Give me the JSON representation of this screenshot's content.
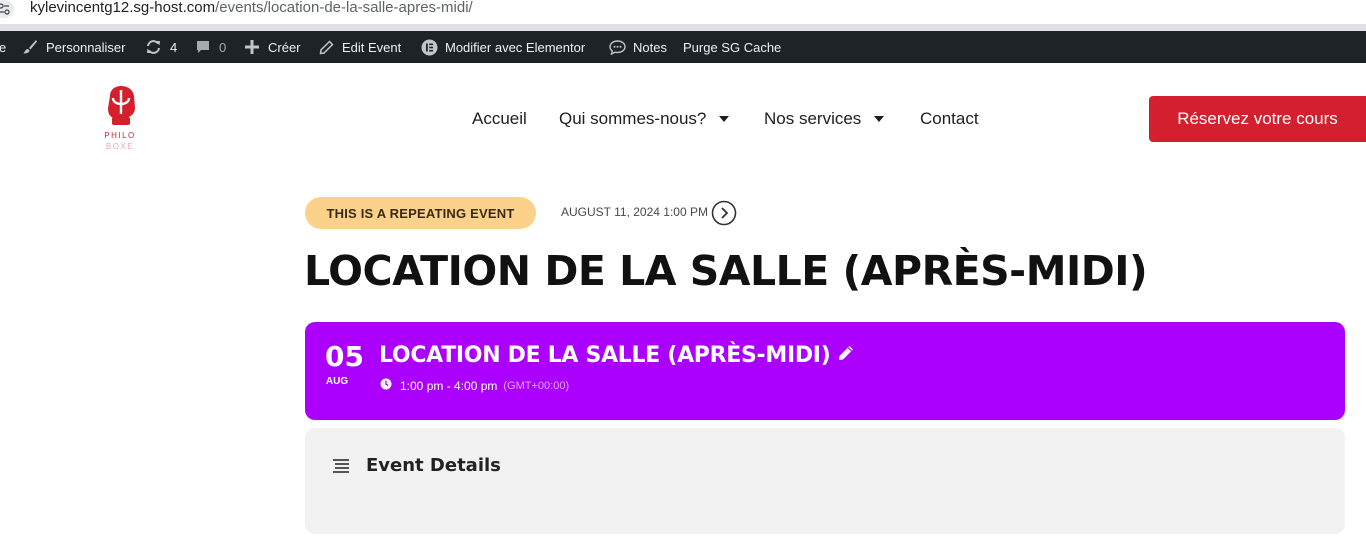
{
  "browser": {
    "url_host": "kylevincentg12.sg-host.com",
    "url_path": "/events/location-de-la-salle-apres-midi/"
  },
  "admin_bar": {
    "site_fragment": "e",
    "customize": "Personnaliser",
    "updates_count": "4",
    "comments_count": "0",
    "create": "Créer",
    "edit_event": "Edit Event",
    "elementor": "Modifier avec Elementor",
    "notes": "Notes",
    "purge_cache": "Purge SG Cache"
  },
  "header": {
    "logo_line1": "PHILO",
    "logo_line2": "BOXE",
    "nav": [
      "Accueil",
      "Qui sommes-nous?",
      "Nos services",
      "Contact"
    ],
    "cta": "Réservez votre cours"
  },
  "event": {
    "repeat_badge": "THIS IS A REPEATING EVENT",
    "datetime": "AUGUST 11, 2024 1:00 PM",
    "title": "LOCATION DE LA SALLE (APRÈS-MIDI)",
    "card": {
      "day": "05",
      "month": "AUG",
      "title": "LOCATION DE LA SALLE (APRÈS-MIDI)",
      "time": "1:00 pm - 4:00 pm",
      "timezone": "(GMT+00:00)"
    },
    "details_heading": "Event Details"
  },
  "colors": {
    "admin_bar_bg": "#1d2327",
    "brand_red": "#d41f2e",
    "badge_bg": "#fcd28a",
    "card_purple": "#ac00ff",
    "details_bg": "#f2f2f2"
  },
  "icons": [
    "tune-icon",
    "brush-icon",
    "refresh-icon",
    "comment-icon",
    "plus-icon",
    "pencil-icon",
    "elementor-icon",
    "notes-icon",
    "chevron-right-circle-icon",
    "clock-icon",
    "edit-pencil-icon",
    "list-icon"
  ]
}
